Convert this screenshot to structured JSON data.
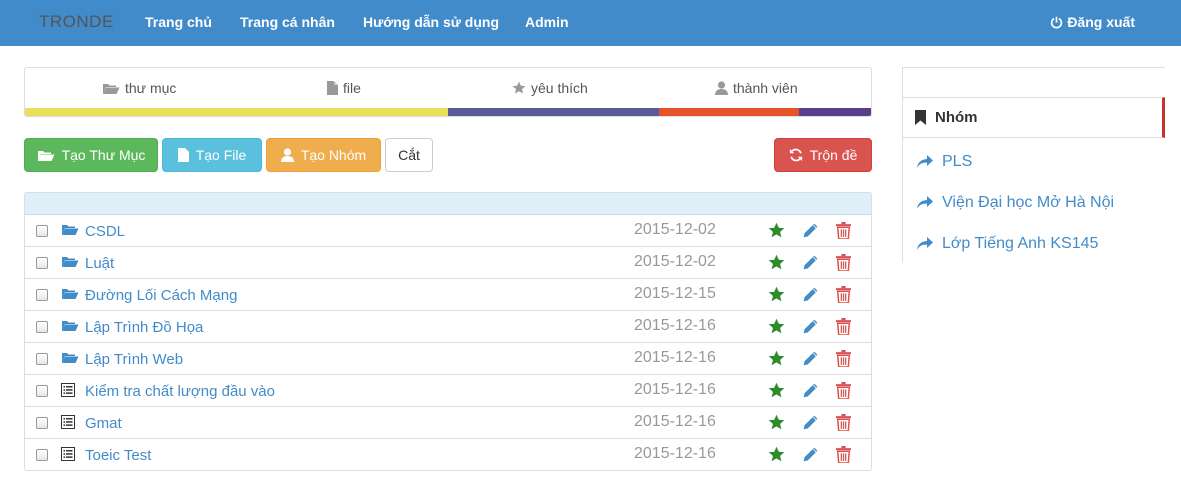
{
  "nav": {
    "brand": "TRONDE",
    "links": [
      "Trang chủ",
      "Trang cá nhân",
      "Hướng dẫn sử dụng",
      "Admin"
    ],
    "logout": "Đăng xuất"
  },
  "stats": [
    {
      "label": "thư mục",
      "icon": "folder-open-icon",
      "color": "#e8e05a"
    },
    {
      "label": "file",
      "icon": "file-icon",
      "color": "#e8e05a"
    },
    {
      "label": "yêu thích",
      "icon": "star-icon",
      "color": "#5b5b9a"
    },
    {
      "label": "thành viên",
      "icon": "user-icon",
      "color": "#e4532a"
    }
  ],
  "toolbar": {
    "create_folder": "Tạo Thư Mục",
    "create_file": "Tạo File",
    "create_group": "Tạo Nhóm",
    "cut": "Cắt",
    "shuffle": "Trộn đề"
  },
  "items": [
    {
      "type": "folder",
      "name": "CSDL",
      "date": "2015-12-02"
    },
    {
      "type": "folder",
      "name": "Luật",
      "date": "2015-12-02"
    },
    {
      "type": "folder",
      "name": "Đường Lối Cách Mạng",
      "date": "2015-12-15"
    },
    {
      "type": "folder",
      "name": "Lập Trình Đồ Họa",
      "date": "2015-12-16"
    },
    {
      "type": "folder",
      "name": "Lập Trình Web",
      "date": "2015-12-16"
    },
    {
      "type": "file",
      "name": "Kiểm tra chất lượng đầu vào",
      "date": "2015-12-16"
    },
    {
      "type": "file",
      "name": "Gmat",
      "date": "2015-12-16"
    },
    {
      "type": "file",
      "name": "Toeic Test",
      "date": "2015-12-16"
    }
  ],
  "sidebar": {
    "title": "Nhóm",
    "groups": [
      "PLS",
      "Viện Đại học Mở Hà Nội",
      "Lớp Tiếng Anh KS145"
    ]
  },
  "colors": {
    "primary": "#428bca",
    "star": "#2e8b2e",
    "danger": "#d9534f"
  }
}
